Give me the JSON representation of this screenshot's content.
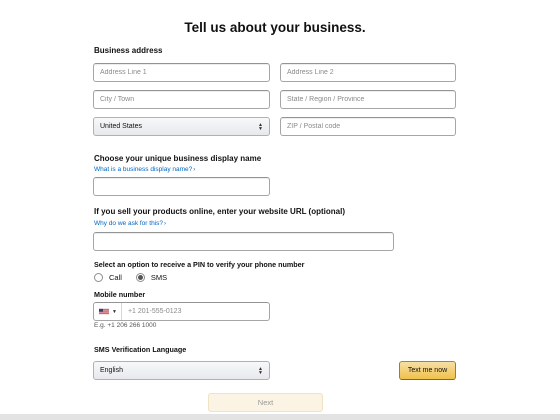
{
  "page": {
    "title": "Tell us about your business."
  },
  "address": {
    "section_label": "Business address",
    "line1_placeholder": "Address Line 1",
    "line2_placeholder": "Address Line 2",
    "city_placeholder": "City / Town",
    "state_placeholder": "State / Region / Province",
    "country_value": "United States",
    "zip_placeholder": "ZIP / Postal code"
  },
  "display_name": {
    "label": "Choose your unique business display name",
    "help_link": "What is a business display name?",
    "value": ""
  },
  "website": {
    "label": "If you sell your products online, enter your website URL (optional)",
    "help_link": "Why do we ask for this?",
    "value": ""
  },
  "pin": {
    "label": "Select an option to receive a PIN to verify your phone number",
    "options": [
      "Call",
      "SMS"
    ],
    "selected": "SMS"
  },
  "phone": {
    "label": "Mobile number",
    "country_flag_icon": "us-flag-icon",
    "placeholder": "+1 201-555-0123",
    "example": "E.g. +1 206 266 1000"
  },
  "sms_language": {
    "label": "SMS Verification Language",
    "value": "English"
  },
  "buttons": {
    "text_me_now": "Text me now",
    "next": "Next"
  },
  "colors": {
    "link": "#0066c0",
    "primary_button": "#f0c14b",
    "next_button_bg": "#fbf3e3"
  }
}
